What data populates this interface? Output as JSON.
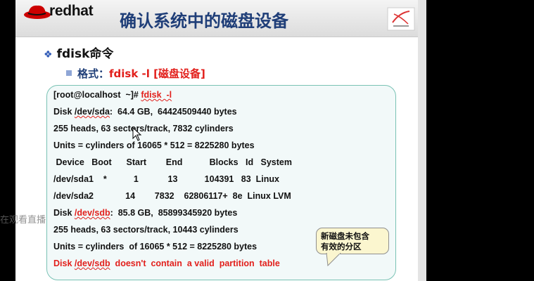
{
  "header": {
    "brand": "redhat",
    "title": "确认系统中的磁盘设备"
  },
  "bullets": {
    "main": "fdisk命令",
    "format_label": "格式：",
    "format_cmd": "fdisk  -l  [磁盘设备]"
  },
  "terminal": {
    "prompt": "[root@localhost  ~]# ",
    "command": "fdisk  -l",
    "sda_prefix": "Disk ",
    "sda_dev": "/dev/sda",
    "sda_rest": ":  64.4 GB,  64424509440 bytes",
    "sda_geom_1": "255 heads, 6",
    "sda_geom_2": "3 sectors/track, 7832 cylinders",
    "sda_units": "Units = cylinders of 16065 * 512 = 8225280 bytes",
    "part_header": " Device   Boot      Start        End           Blocks   Id   System",
    "part_row1": "/dev/sda1    *           1            13           104391   83  Linux",
    "part_row2": "/dev/sda2             14        7832    62806117+  8e  Linux LVM",
    "sdb_prefix": "Disk ",
    "sdb_dev": "/dev/sdb",
    "sdb_rest": ":  85.8 GB,  85899345920 bytes",
    "sdb_geom": "255 heads, 63 sectors/track, 10443 cylinders",
    "sdb_units": "Units = cylinders  of 16065 * 512 = 8225280 bytes",
    "error_1": "Disk ",
    "error_dev": "/dev/sdb",
    "error_2": "  doesn't  contain  a valid  partition  table"
  },
  "callout": {
    "line1": "新磁盘未包含",
    "line2": "有效的分区"
  },
  "overlay": {
    "watermark": "在观看直播"
  },
  "colors": {
    "title": "#1f3e78",
    "accent_red": "#e2201c",
    "terminal_border": "#79c2b4",
    "callout_bg": "#fbf6cf"
  }
}
